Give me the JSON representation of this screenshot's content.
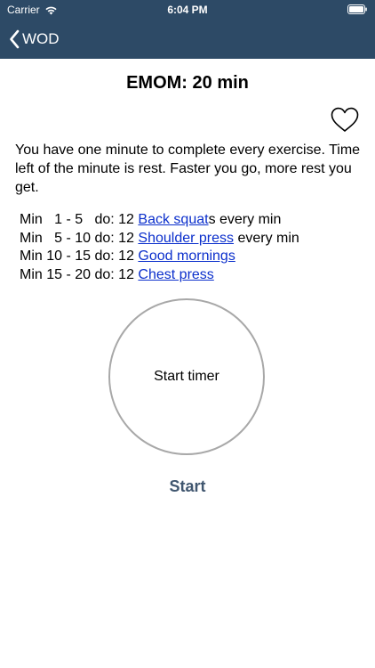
{
  "status_bar": {
    "carrier": "Carrier",
    "time": "6:04 PM",
    "wifi_icon": "wifi-icon",
    "battery_icon": "battery-icon"
  },
  "nav": {
    "back_label": "WOD",
    "back_icon": "chevron-left-icon"
  },
  "workout": {
    "title": "EMOM: 20 min",
    "favorite_icon": "heart-outline-icon",
    "description": "You have one minute to complete every exercise. Time left of the minute is rest. Faster you go, more rest you get.",
    "schedule": [
      {
        "prefix": "Min   1 - 5   do: 12 ",
        "exercise": "Back squat",
        "suffix": "s every min"
      },
      {
        "prefix": "Min   5 - 10 do: 12 ",
        "exercise": "Shoulder press",
        "suffix": " every min"
      },
      {
        "prefix": "Min 10 - 15 do: 12 ",
        "exercise": "Good mornings",
        "suffix": ""
      },
      {
        "prefix": "Min 15 - 20 do: 12 ",
        "exercise": "Chest press",
        "suffix": ""
      }
    ]
  },
  "timer": {
    "label": "Start timer",
    "start_button": "Start"
  },
  "colors": {
    "nav_background": "#2d4a66",
    "link": "#0b2fcc",
    "start_button": "#40566f",
    "timer_ring": "#a8a8a8"
  }
}
